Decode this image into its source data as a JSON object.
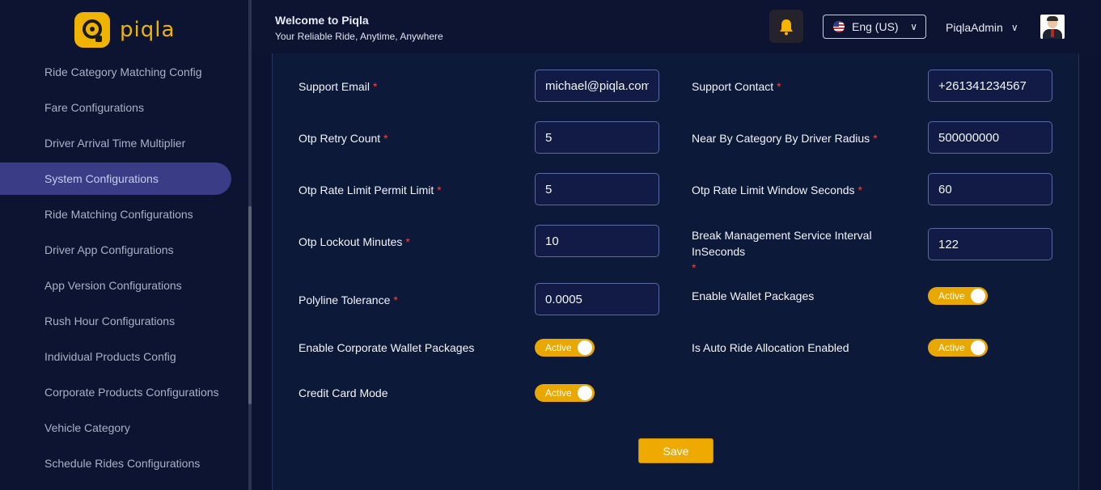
{
  "brand": {
    "name": "piqla"
  },
  "sidebar": {
    "items": [
      {
        "label": "Ride Category Matching Config"
      },
      {
        "label": "Fare Configurations"
      },
      {
        "label": "Driver Arrival Time Multiplier"
      },
      {
        "label": "System Configurations",
        "active": true
      },
      {
        "label": "Ride Matching Configurations"
      },
      {
        "label": "Driver App Configurations"
      },
      {
        "label": "App Version Configurations"
      },
      {
        "label": "Rush Hour Configurations"
      },
      {
        "label": "Individual Products Config"
      },
      {
        "label": "Corporate Products Configurations"
      },
      {
        "label": "Vehicle Category"
      },
      {
        "label": "Schedule Rides Configurations"
      }
    ]
  },
  "header": {
    "welcome": "Welcome to Piqla",
    "tagline": "Your Reliable Ride, Anytime, Anywhere",
    "language": "Eng (US)",
    "user": "PiqlaAdmin",
    "bell_icon": "bell-icon"
  },
  "form": {
    "support_email": {
      "label": "Support Email",
      "required": "*",
      "value": "michael@piqla.com"
    },
    "support_contact": {
      "label": "Support Contact",
      "required": "*",
      "value": "+261341234567"
    },
    "otp_retry_count": {
      "label": "Otp Retry Count",
      "required": "*",
      "value": "5"
    },
    "near_by_radius": {
      "label": "Near By Category By Driver Radius",
      "required": "*",
      "value": "500000000"
    },
    "otp_rate_limit": {
      "label": "Otp Rate Limit Permit Limit",
      "required": "*",
      "value": "5"
    },
    "otp_window": {
      "label": "Otp Rate Limit Window Seconds",
      "required": "*",
      "value": "60"
    },
    "otp_lockout": {
      "label": "Otp Lockout Minutes",
      "required": "*",
      "value": "10"
    },
    "break_interval": {
      "label": "Break Management Service Interval InSeconds",
      "required": "*",
      "value": "122"
    },
    "polyline": {
      "label": "Polyline Tolerance",
      "required": "*",
      "value": "0.0005"
    },
    "wallet_packages": {
      "label": "Enable Wallet Packages",
      "status": "Active"
    },
    "corporate_wallet": {
      "label": "Enable Corporate Wallet Packages",
      "status": "Active"
    },
    "auto_ride": {
      "label": "Is Auto Ride Allocation Enabled",
      "status": "Active"
    },
    "credit_card": {
      "label": "Credit Card Mode",
      "status": "Active"
    },
    "save_label": "Save"
  },
  "colors": {
    "accent": "#eeaa00",
    "active_nav": "#3a3d86",
    "background": "#0b1330",
    "required": "#e04a4a"
  }
}
